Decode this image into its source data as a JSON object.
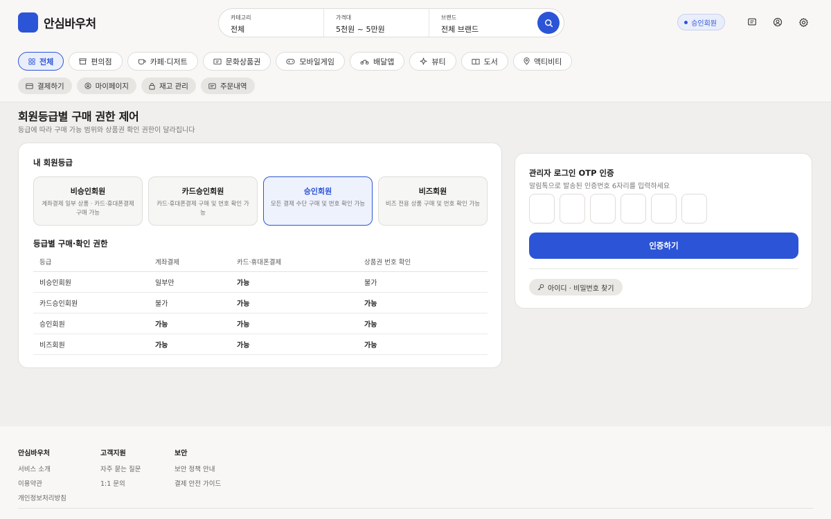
{
  "brand": {
    "name": "안심바우처",
    "color": "#2c54d6"
  },
  "search": {
    "segments": [
      {
        "label": "카테고리",
        "value": "전체"
      },
      {
        "label": "가격대",
        "value": "5천원 ~ 5만원"
      },
      {
        "label": "브랜드",
        "value": "전체 브랜드"
      }
    ],
    "button_icon": "search-icon"
  },
  "header": {
    "member_badge": "승인회원",
    "icons": [
      "chat-icon",
      "user-icon",
      "gear-icon"
    ]
  },
  "categories": [
    {
      "label": "전체",
      "icon": "grid-icon",
      "active": true
    },
    {
      "label": "편의점",
      "icon": "store-icon"
    },
    {
      "label": "카페·디저트",
      "icon": "cup-icon"
    },
    {
      "label": "문화상품권",
      "icon": "ticket-icon"
    },
    {
      "label": "모바일게임",
      "icon": "gamepad-icon"
    },
    {
      "label": "배달앱",
      "icon": "bike-icon"
    },
    {
      "label": "뷰티",
      "icon": "sparkle-icon"
    },
    {
      "label": "도서",
      "icon": "book-icon"
    },
    {
      "label": "액티비티",
      "icon": "pin-icon"
    }
  ],
  "quick_links": [
    {
      "label": "결제하기",
      "icon": "card-icon"
    },
    {
      "label": "마이페이지",
      "icon": "user-icon"
    },
    {
      "label": "재고 관리",
      "icon": "lock-icon"
    },
    {
      "label": "주문내역",
      "icon": "receipt-icon"
    }
  ],
  "page": {
    "title": "회원등급별 구매 권한 제어",
    "subtitle": "등급에 따라 구매 가능 범위와 상품권 확인 권한이 달라집니다"
  },
  "tiers_section": {
    "title": "내 회원등급",
    "tiers": [
      {
        "name": "비승인회원",
        "desc": "계좌결제 일부 상품 · 카드·휴대폰결제 구매 가능"
      },
      {
        "name": "카드승인회원",
        "desc": "카드·휴대폰결제 구매 및 번호 확인 가능"
      },
      {
        "name": "승인회원",
        "desc": "모든 결제 수단 구매 및 번호 확인 가능",
        "active": true
      },
      {
        "name": "비즈회원",
        "desc": "비즈 전용 상품 구매 및 번호 확인 가능"
      }
    ]
  },
  "permissions": {
    "title": "등급별 구매·확인 권한",
    "columns": [
      "등급",
      "계좌결제",
      "카드·휴대폰결제",
      "상품권 번호 확인"
    ],
    "rows": [
      [
        "비승인회원",
        "일부만",
        "가능",
        "불가"
      ],
      [
        "카드승인회원",
        "불가",
        "가능",
        "가능"
      ],
      [
        "승인회원",
        "가능",
        "가능",
        "가능"
      ],
      [
        "비즈회원",
        "가능",
        "가능",
        "가능"
      ]
    ]
  },
  "otp": {
    "title": "관리자 로그인 OTP 인증",
    "subtitle": "알림톡으로 발송된 인증번호 6자리를 입력하세요",
    "digits": [
      "",
      "",
      "",
      "",
      "",
      ""
    ],
    "verify_label": "인증하기",
    "find_label": "아이디 · 비밀번호 찾기"
  },
  "footer": {
    "columns": [
      {
        "title": "안심바우처",
        "links": [
          "서비스 소개",
          "이용약관",
          "개인정보처리방침"
        ]
      },
      {
        "title": "고객지원",
        "links": [
          "자주 묻는 질문",
          "1:1 문의"
        ]
      },
      {
        "title": "보안",
        "links": [
          "보안 정책 안내",
          "결제 안전 가이드"
        ]
      }
    ]
  }
}
